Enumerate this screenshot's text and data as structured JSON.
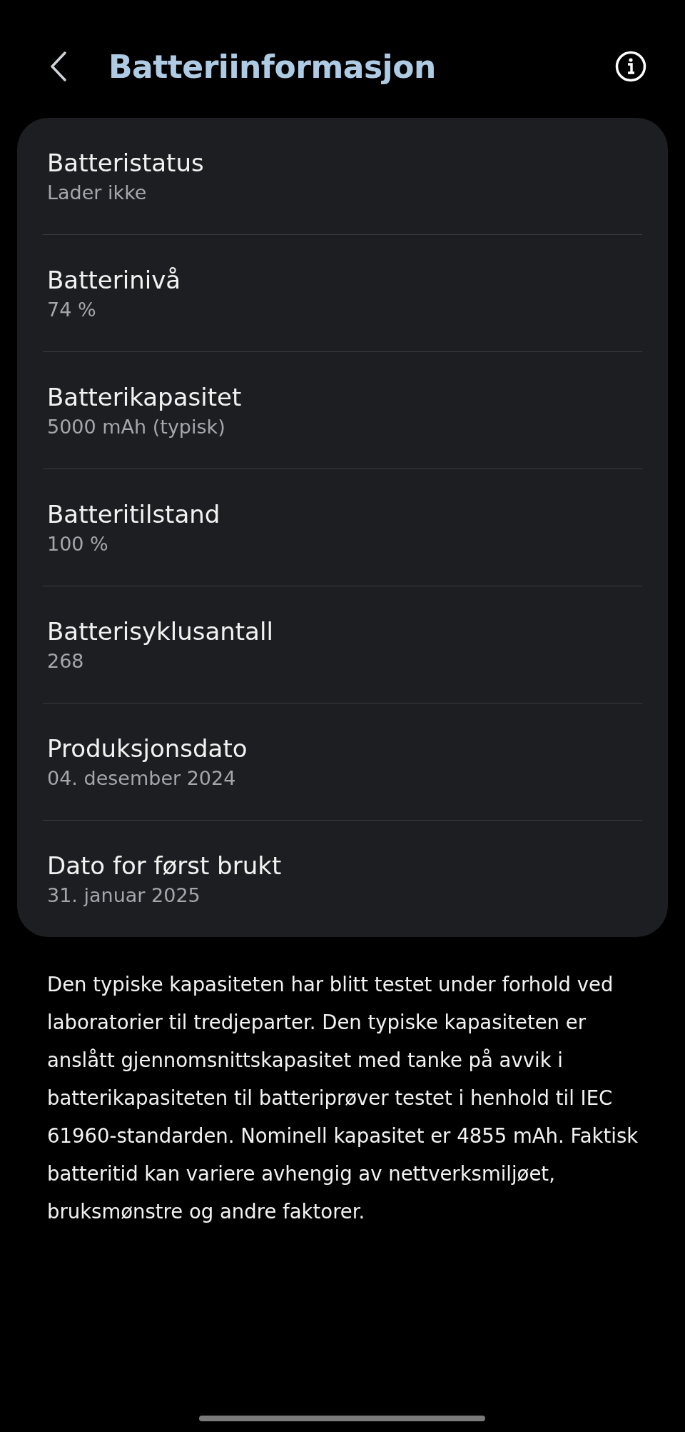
{
  "header": {
    "title": "Batteriinformasjon"
  },
  "items": [
    {
      "label": "Batteristatus",
      "value": "Lader ikke"
    },
    {
      "label": "Batterinivå",
      "value": "74 %"
    },
    {
      "label": "Batterikapasitet",
      "value": "5000 mAh (typisk)"
    },
    {
      "label": "Batteritilstand",
      "value": "100 %"
    },
    {
      "label": "Batterisyklusantall",
      "value": "268"
    },
    {
      "label": "Produksjonsdato",
      "value": "04. desember 2024"
    },
    {
      "label": "Dato for først brukt",
      "value": "31. januar 2025"
    }
  ],
  "note": "Den typiske kapasiteten har blitt testet under forhold ved laboratorier til tredjeparter. Den typiske kapasiteten er anslått gjennomsnittskapasitet med tanke på avvik i batterikapasiteten til batteriprøver testet i henhold til IEC 61960-standarden. Nominell kapasitet er 4855 mAh. Faktisk batteritid kan variere avhengig av nettverksmiljøet, bruksmønstre og andre faktorer."
}
